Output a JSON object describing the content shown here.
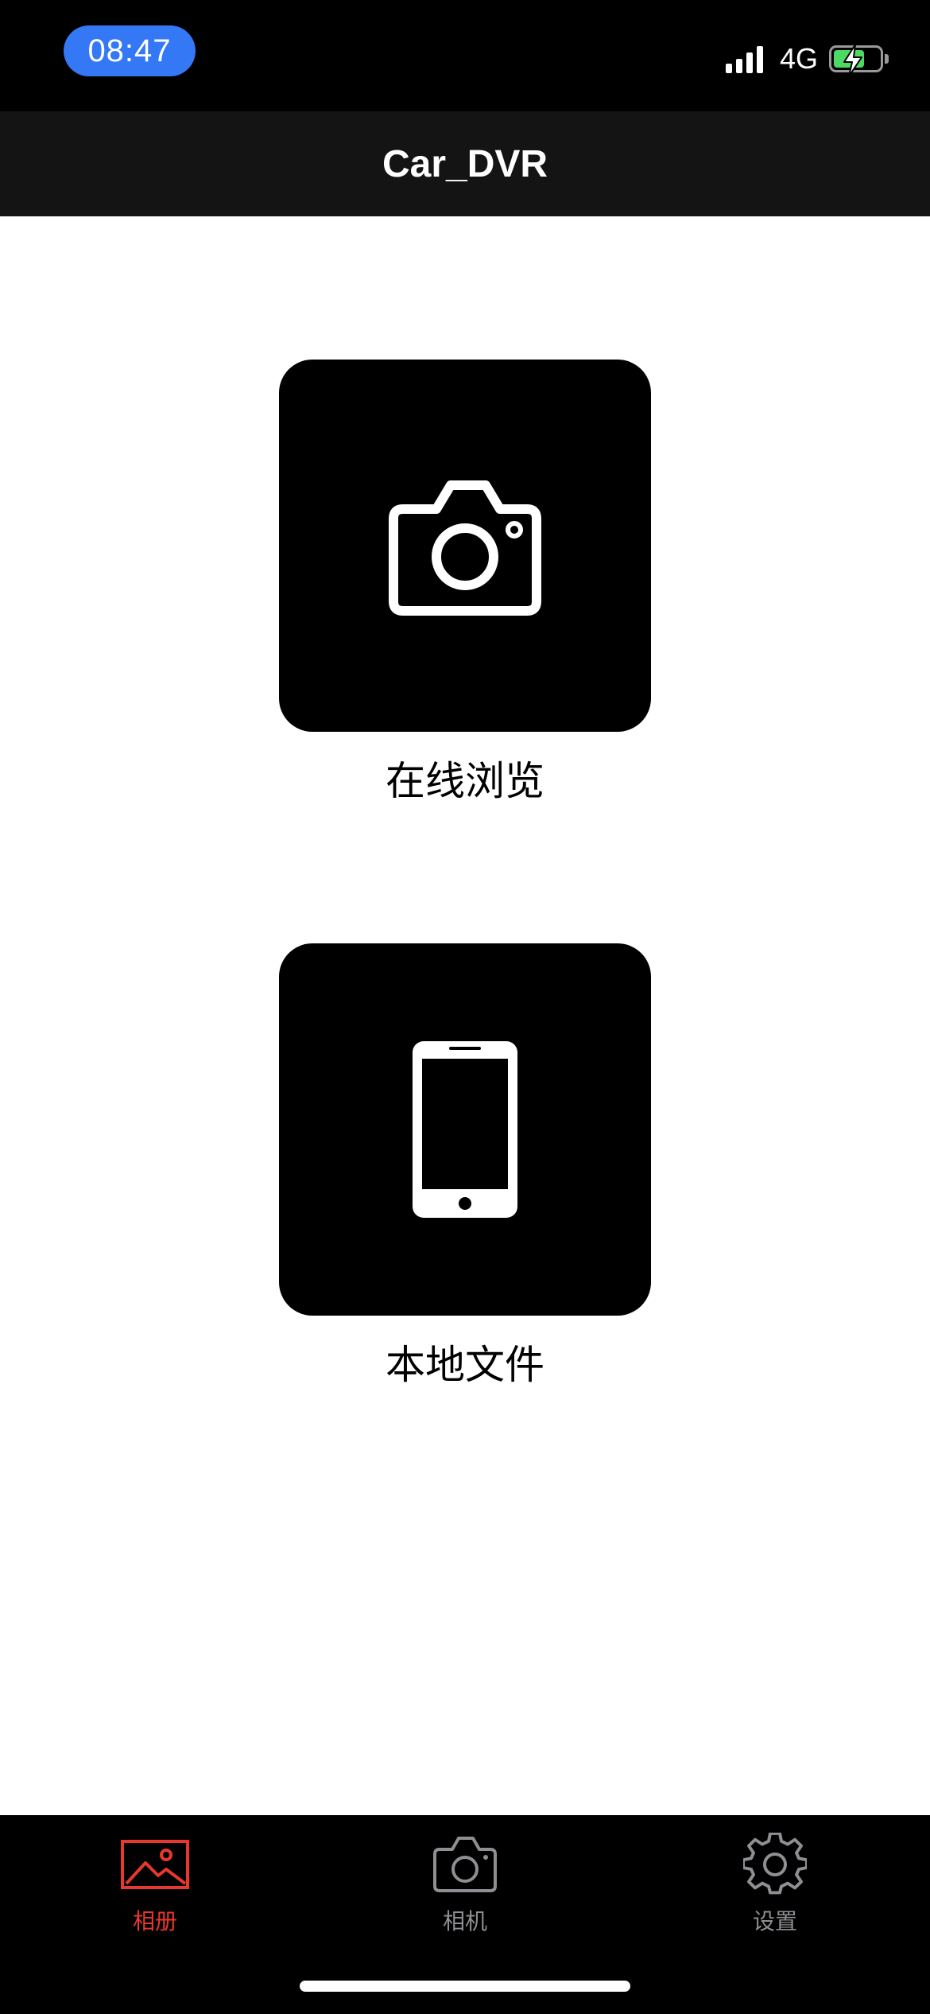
{
  "status_bar": {
    "time": "08:47",
    "network": "4G",
    "battery_charging": true
  },
  "nav": {
    "title": "Car_DVR"
  },
  "tiles": [
    {
      "label": "在线浏览",
      "icon": "camera-icon"
    },
    {
      "label": "本地文件",
      "icon": "phone-icon"
    }
  ],
  "tab_bar": {
    "active_color": "#e8372c",
    "inactive_color": "#8e8e93",
    "tabs": [
      {
        "label": "相册",
        "icon": "photo-album-icon",
        "active": true
      },
      {
        "label": "相机",
        "icon": "camera-icon",
        "active": false
      },
      {
        "label": "设置",
        "icon": "gear-icon",
        "active": false
      }
    ]
  }
}
